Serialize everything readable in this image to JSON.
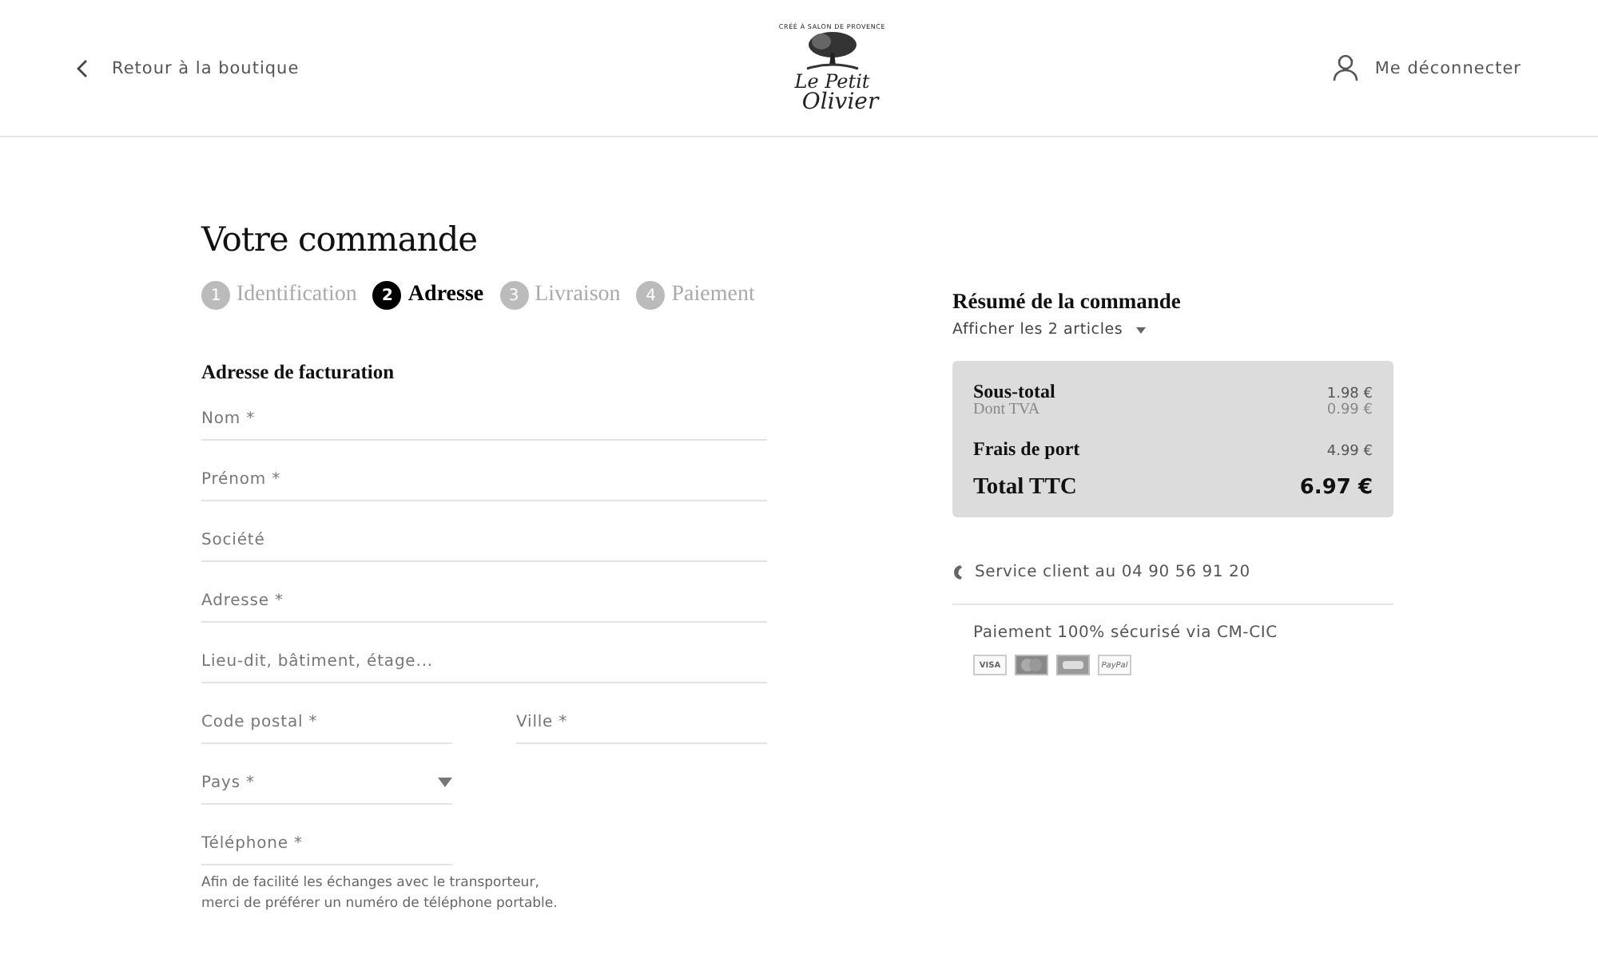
{
  "header": {
    "back_link": "Retour à la boutique",
    "logo": {
      "tagline": "CRÉÉ À SALON DE PROVENCE",
      "name_top": "Le Petit",
      "name_bottom": "Olivier"
    },
    "account_link": "Me déconnecter"
  },
  "title": "Votre commande",
  "steps": [
    {
      "number": "1",
      "label": "Identification",
      "selected": false
    },
    {
      "number": "2",
      "label": "Adresse",
      "selected": true
    },
    {
      "number": "3",
      "label": "Livraison",
      "selected": false
    },
    {
      "number": "4",
      "label": "Paiement",
      "selected": false
    }
  ],
  "billing": {
    "heading": "Adresse de facturation",
    "rows": [
      [
        {
          "kind": "text",
          "placeholder": "Nom *"
        }
      ],
      [
        {
          "kind": "text",
          "placeholder": "Prénom *"
        }
      ],
      [
        {
          "kind": "text",
          "placeholder": "Société"
        }
      ],
      [
        {
          "kind": "text",
          "placeholder": "Adresse *"
        }
      ],
      [
        {
          "kind": "text",
          "placeholder": "Lieu-dit, bâtiment, étage..."
        }
      ],
      [
        {
          "kind": "text",
          "placeholder": "Code postal *"
        },
        {
          "kind": "text",
          "placeholder": "Ville *"
        }
      ],
      [
        {
          "kind": "select",
          "placeholder": "Pays *"
        }
      ],
      [
        {
          "kind": "phone",
          "placeholder": "Téléphone *",
          "help": "Afin de facilité les échanges avec le transporteur, merci de préférer un numéro de téléphone portable."
        }
      ]
    ]
  },
  "summary": {
    "heading": "Résumé de la commande",
    "toggle": "Afficher les 2 articles",
    "lines": [
      {
        "kind": "main",
        "label": "Sous-total",
        "value": "1.98 €"
      },
      {
        "kind": "sub",
        "label": "Dont TVA",
        "value": "0.99 €"
      },
      {
        "kind": "main",
        "label": "Frais de port",
        "value": "4.99 €"
      },
      {
        "kind": "total",
        "label": "Total TTC",
        "value": "6.97 €"
      }
    ],
    "service": "Service client au 04 90 56 91 20",
    "payment": "Paiement 100% sécurisé via CM-CIC",
    "cards": [
      {
        "kind": "visa",
        "text": "VISA"
      },
      {
        "kind": "mastercard"
      },
      {
        "kind": "cb"
      },
      {
        "kind": "paypal",
        "text": "PayPal"
      }
    ]
  }
}
